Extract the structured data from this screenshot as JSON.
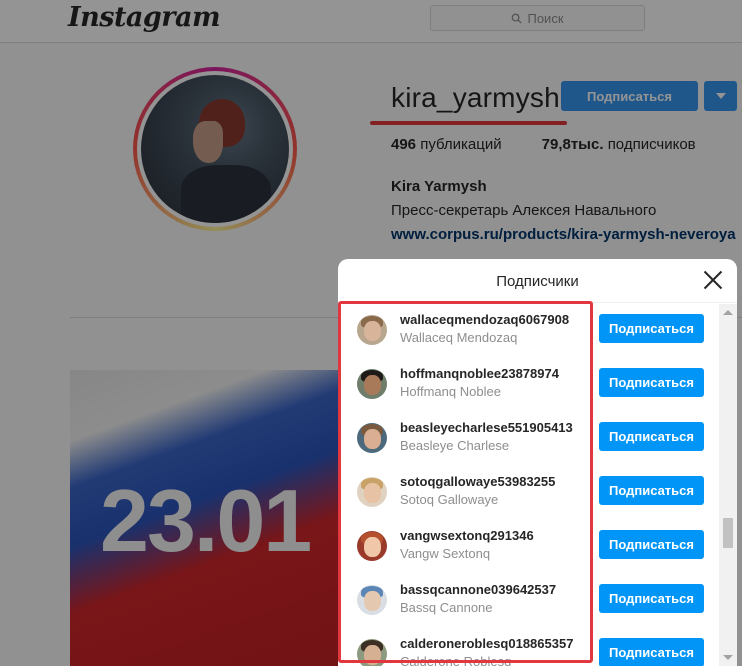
{
  "header": {
    "logo": "Instagram",
    "search_placeholder": "Поиск"
  },
  "profile": {
    "username": "kira_yarmysh",
    "follow_label": "Подписаться",
    "posts_count": "496",
    "posts_label": "публикаций",
    "followers_count": "79,8тыс.",
    "followers_label": "подписчиков",
    "full_name": "Kira Yarmysh",
    "bio": "Пресс-секретарь Алексея Навального",
    "link": "www.corpus.ru/products/kira-yarmysh-neveroya"
  },
  "post": {
    "overlay_text": "23.01"
  },
  "modal": {
    "title": "Подписчики",
    "follow_label": "Подписаться",
    "followers": [
      {
        "login": "wallaceqmendozaq6067908",
        "name": "Wallaceq Mendozaq"
      },
      {
        "login": "hoffmanqnoblee23878974",
        "name": "Hoffmanq Noblee"
      },
      {
        "login": "beasleyecharlese551905413",
        "name": "Beasleye Charlese"
      },
      {
        "login": "sotoqgallowaye53983255",
        "name": "Sotoq Gallowaye"
      },
      {
        "login": "vangwsextonq291346",
        "name": "Vangw Sextonq"
      },
      {
        "login": "bassqcannone039642537",
        "name": "Bassq Cannone"
      },
      {
        "login": "calderoneroblesq018865357",
        "name": "Calderonе Roblesq"
      }
    ]
  },
  "colors": {
    "accent": "#0095f6",
    "highlight": "#e0383e"
  }
}
